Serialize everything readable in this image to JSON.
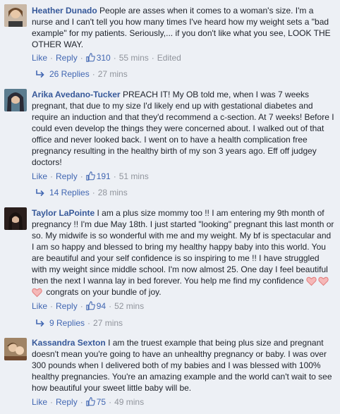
{
  "comments": [
    {
      "author": "Heather Dunado",
      "text": "People are asses when it comes to a woman's size. I'm a nurse and I can't tell you how many times I've heard how my weight sets a \"bad example\" for my patients. Seriously,... if you don't like what you see, LOOK THE OTHER WAY.",
      "like_label": "Like",
      "reply_label": "Reply",
      "likes": "310",
      "time": "55 mins",
      "edited": "Edited",
      "replies": "26 Replies",
      "replies_time": "27 mins",
      "avatar_color": "#b8a08a"
    },
    {
      "author": "Arika Avedano-Tucker",
      "text": "PREACH IT! My OB told me, when I was 7 weeks pregnant, that due to my size I'd likely end up with gestational diabetes and require an induction and that they'd recommend a c-section. At 7 weeks! Before I could even develop the things they were concerned about. I walked out of that office and never looked back. I went on to have a health complication free pregnancy resulting in the healthy birth of my son 3 years ago. Eff off judgey doctors!",
      "like_label": "Like",
      "reply_label": "Reply",
      "likes": "191",
      "time": "51 mins",
      "replies": "14 Replies",
      "replies_time": "28 mins",
      "avatar_color": "#4a6a80"
    },
    {
      "author": "Taylor LaPointe",
      "text": "I am a plus size mommy too !! I am entering my 9th month of pregnancy !! I'm due May 18th. I just started \"looking\" pregnant this last month or so. My midwife is so wonderful with me and my weight. My bf is spectacular and I am so happy and blessed to bring my healthy happy baby into this world. You are beautiful and your self confidence is so inspiring to me !! I have struggled with my weight since middle school. I'm now almost 25. One day I feel beautiful then the next I wanna lay in bed forever. You help me find my confidence",
      "text_after": "congrats on your bundle of joy.",
      "like_label": "Like",
      "reply_label": "Reply",
      "likes": "94",
      "time": "52 mins",
      "replies": "9 Replies",
      "replies_time": "27 mins",
      "avatar_color": "#3a2a28"
    },
    {
      "author": "Kassandra Sexton",
      "text": "I am the truest example that being plus size and pregnant doesn't mean you're going to have an unhealthy pregnancy or baby. I was over 300 pounds when I delivered both of my babies and I was blessed with 100% healthy pregnancies. You're an amazing example and the world can't wait to see how beautiful your sweet little baby will be.",
      "like_label": "Like",
      "reply_label": "Reply",
      "likes": "75",
      "time": "49 mins",
      "avatar_color": "#8a6a50"
    }
  ],
  "colors": {
    "link": "#4267b2",
    "author": "#365899",
    "meta": "#90949c",
    "background": "#edf0f5"
  },
  "icons": [
    "thumbs-up-icon",
    "reply-arrow-icon",
    "heart-icon"
  ]
}
